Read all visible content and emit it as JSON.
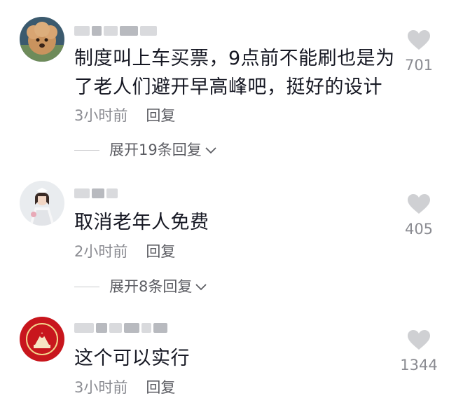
{
  "comments": [
    {
      "text_lines": [
        "制度叫上车买票，9点前不能刷也是为",
        "了老人们避开早高峰吧，挺好的设计"
      ],
      "time": "3小时前",
      "reply_label": "回复",
      "likes": "701",
      "expand_label": "展开19条回复"
    },
    {
      "text_lines": [
        "取消老年人免费"
      ],
      "time": "2小时前",
      "reply_label": "回复",
      "likes": "405",
      "expand_label": "展开8条回复"
    },
    {
      "text_lines": [
        "这个可以实行"
      ],
      "time": "3小时前",
      "reply_label": "回复",
      "likes": "1344"
    }
  ],
  "colors": {
    "text": "#161823",
    "meta": "#8a8b91",
    "heart": "#cfd0d3"
  }
}
